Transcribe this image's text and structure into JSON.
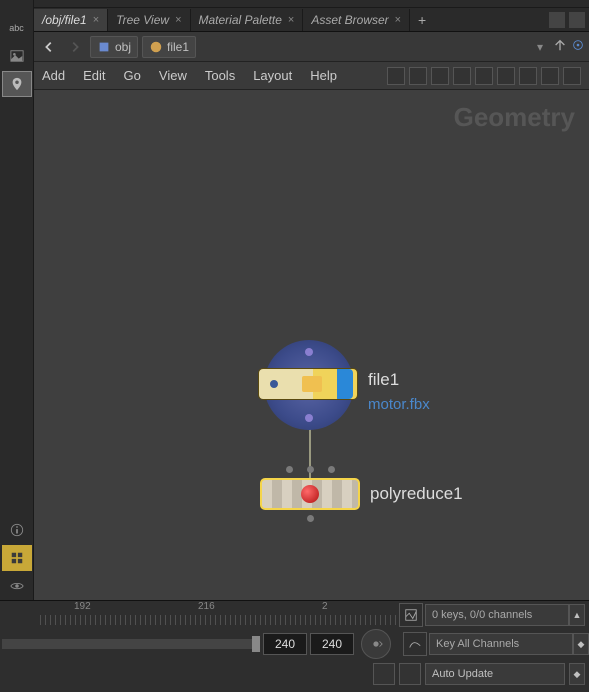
{
  "left_rail": {
    "tools": [
      "abc",
      "image",
      "pin",
      "info",
      "grid",
      "eye"
    ]
  },
  "tabs": [
    {
      "label": "/obj/file1",
      "active": true
    },
    {
      "label": "Tree View",
      "active": false
    },
    {
      "label": "Material Palette",
      "active": false
    },
    {
      "label": "Asset Browser",
      "active": false
    }
  ],
  "path": {
    "seg1": "obj",
    "seg2": "file1"
  },
  "menu": {
    "add": "Add",
    "edit": "Edit",
    "go": "Go",
    "view": "View",
    "tools": "Tools",
    "layout": "Layout",
    "help": "Help"
  },
  "watermark": "Geometry",
  "nodes": {
    "file": {
      "name": "file1",
      "source": "motor.fbx"
    },
    "polyreduce": {
      "name": "polyreduce1"
    }
  },
  "timeline": {
    "ticks": [
      "192",
      "216",
      "2"
    ],
    "frame_current": "240",
    "frame_end": "240",
    "keys_label": "0 keys, 0/0 channels",
    "key_all": "Key All Channels",
    "auto_update": "Auto Update"
  }
}
